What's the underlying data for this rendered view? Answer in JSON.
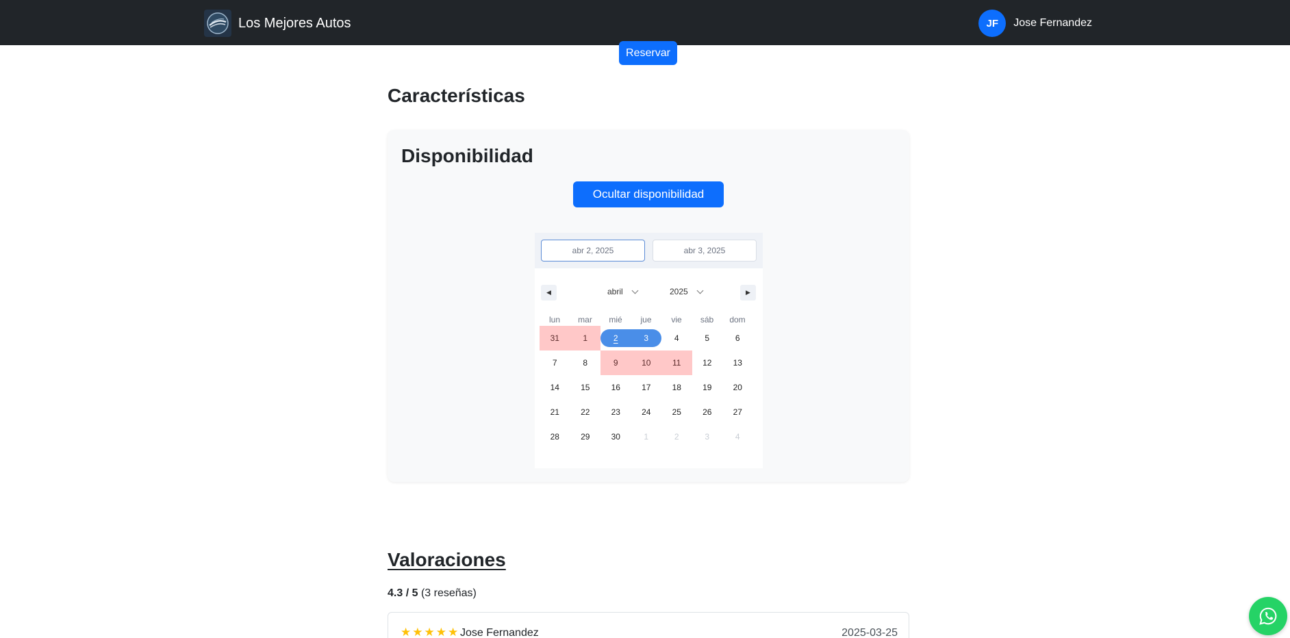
{
  "navbar": {
    "brand_title": "Los Mejores Autos",
    "user_initials": "JF",
    "user_name": "Jose Fernandez",
    "brand_icon": "car-logo-icon"
  },
  "reserve_label": "Reservar",
  "features_title": "Características",
  "availability": {
    "title": "Disponibilidad",
    "toggle_label": "Ocultar disponibilidad",
    "calendar": {
      "start_date": "abr 2, 2025",
      "end_date": "abr 3, 2025",
      "month": "abril",
      "year": "2025",
      "weekdays": [
        "lun",
        "mar",
        "mié",
        "jue",
        "vie",
        "sáb",
        "dom"
      ],
      "weeks": [
        [
          {
            "d": "31",
            "s": "blocked"
          },
          {
            "d": "1",
            "s": "blocked"
          },
          {
            "d": "2",
            "s": "range-start"
          },
          {
            "d": "3",
            "s": "range-end"
          },
          {
            "d": "4",
            "s": ""
          },
          {
            "d": "5",
            "s": ""
          },
          {
            "d": "6",
            "s": ""
          }
        ],
        [
          {
            "d": "7",
            "s": ""
          },
          {
            "d": "8",
            "s": ""
          },
          {
            "d": "9",
            "s": "blocked"
          },
          {
            "d": "10",
            "s": "blocked"
          },
          {
            "d": "11",
            "s": "blocked"
          },
          {
            "d": "12",
            "s": ""
          },
          {
            "d": "13",
            "s": ""
          }
        ],
        [
          {
            "d": "14",
            "s": ""
          },
          {
            "d": "15",
            "s": ""
          },
          {
            "d": "16",
            "s": ""
          },
          {
            "d": "17",
            "s": ""
          },
          {
            "d": "18",
            "s": ""
          },
          {
            "d": "19",
            "s": ""
          },
          {
            "d": "20",
            "s": ""
          }
        ],
        [
          {
            "d": "21",
            "s": ""
          },
          {
            "d": "22",
            "s": ""
          },
          {
            "d": "23",
            "s": ""
          },
          {
            "d": "24",
            "s": ""
          },
          {
            "d": "25",
            "s": ""
          },
          {
            "d": "26",
            "s": ""
          },
          {
            "d": "27",
            "s": ""
          }
        ],
        [
          {
            "d": "28",
            "s": ""
          },
          {
            "d": "29",
            "s": ""
          },
          {
            "d": "30",
            "s": ""
          },
          {
            "d": "1",
            "s": "out"
          },
          {
            "d": "2",
            "s": "out"
          },
          {
            "d": "3",
            "s": "out"
          },
          {
            "d": "4",
            "s": "out"
          }
        ]
      ],
      "colors": {
        "blocked": "#ffc8c8",
        "selected": "#4a8ee8"
      }
    }
  },
  "reviews": {
    "title": "Valoraciones",
    "average": "4.3 / 5",
    "count_text": "(3 reseñas)",
    "items": [
      {
        "stars": 5,
        "author": "Jose Fernandez",
        "date": "2025-03-25"
      }
    ]
  },
  "whatsapp_icon": "whatsapp-icon",
  "accent_color": "#0d6efd"
}
